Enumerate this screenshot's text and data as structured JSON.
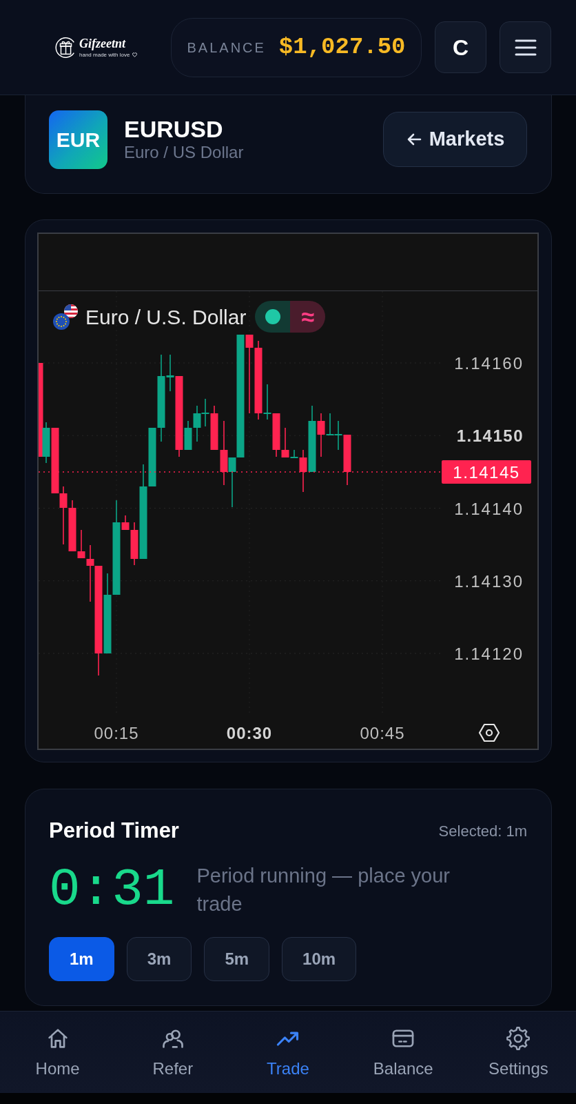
{
  "header": {
    "logo": {
      "name": "Gifzeetnt",
      "tagline": "hand made with love"
    },
    "balance": {
      "label": "BALANCE",
      "amount": "$1,027.50"
    },
    "account_button": "C"
  },
  "asset": {
    "badge": "EUR",
    "symbol": "EURUSD",
    "name": "Euro / US Dollar",
    "back_button": "Markets"
  },
  "chart": {
    "legend": {
      "title": "Euro / U.S. Dollar",
      "wave_symbol": "≈"
    },
    "price_labels": [
      {
        "text": "1.14160",
        "emphasized": false
      },
      {
        "text": "1.14150",
        "emphasized": true
      },
      {
        "text": "1.14140",
        "emphasized": false
      },
      {
        "text": "1.14130",
        "emphasized": false
      },
      {
        "text": "1.14120",
        "emphasized": false
      }
    ],
    "current_price": "1.14145",
    "time_labels": [
      {
        "text": "00:15",
        "emphasized": false
      },
      {
        "text": "00:30",
        "emphasized": true
      },
      {
        "text": "00:45",
        "emphasized": false
      }
    ]
  },
  "period_timer": {
    "title": "Period Timer",
    "selected_label": "Selected: 1m",
    "countdown": "0:31",
    "status": "Period running — place your trade",
    "options": [
      {
        "label": "1m",
        "selected": true
      },
      {
        "label": "3m",
        "selected": false
      },
      {
        "label": "5m",
        "selected": false
      },
      {
        "label": "10m",
        "selected": false
      }
    ]
  },
  "bottom_nav": [
    {
      "label": "Home",
      "selected": false
    },
    {
      "label": "Refer",
      "selected": false
    },
    {
      "label": "Trade",
      "selected": true
    },
    {
      "label": "Balance",
      "selected": false
    },
    {
      "label": "Settings",
      "selected": false
    }
  ]
}
